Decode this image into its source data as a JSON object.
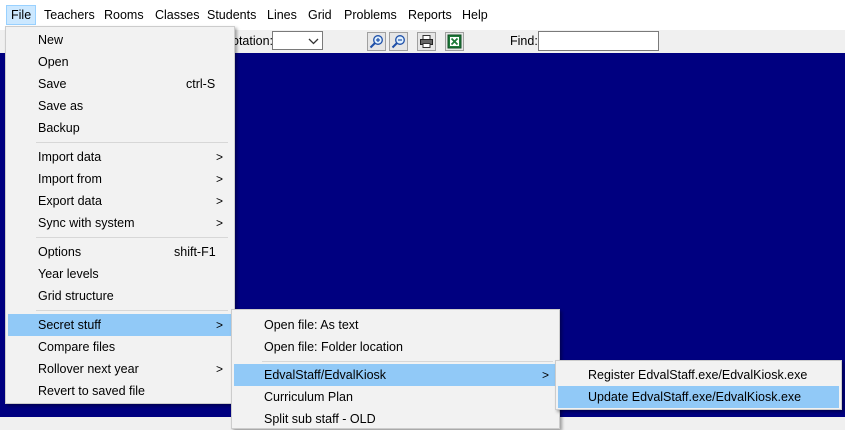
{
  "menubar": {
    "items": [
      "File",
      "Teachers",
      "Rooms",
      "Classes",
      "Students",
      "Lines",
      "Grid",
      "Problems",
      "Reports",
      "Help"
    ]
  },
  "toolbar": {
    "rotation_label": "otation:",
    "rotation_value": "",
    "find_label": "Find:",
    "find_value": "",
    "icons": [
      "zoom-in-icon",
      "zoom-out-icon",
      "print-icon",
      "excel-export-icon"
    ]
  },
  "canvas": {
    "background": "#000080"
  },
  "file_menu": {
    "items": [
      {
        "label": "New"
      },
      {
        "label": "Open"
      },
      {
        "label": "Save",
        "shortcut": "ctrl-S"
      },
      {
        "label": "Save as"
      },
      {
        "label": "Backup"
      },
      {
        "label": "Import data",
        "submenu": true
      },
      {
        "label": "Import from",
        "submenu": true
      },
      {
        "label": "Export data",
        "submenu": true
      },
      {
        "label": "Sync with system",
        "submenu": true
      },
      {
        "label": "Options",
        "shortcut": "shift-F1"
      },
      {
        "label": "Year levels"
      },
      {
        "label": "Grid structure"
      },
      {
        "label": "Secret stuff",
        "submenu": true,
        "highlighted": true
      },
      {
        "label": "Compare files"
      },
      {
        "label": "Rollover next year",
        "submenu": true
      },
      {
        "label": "Revert to saved file"
      }
    ],
    "arrow": ">"
  },
  "secret_menu": {
    "items": [
      {
        "label": "Open file: As text"
      },
      {
        "label": "Open file: Folder location"
      },
      {
        "label": "EdvalStaff/EdvalKiosk",
        "submenu": true,
        "highlighted": true
      },
      {
        "label": "Curriculum Plan"
      },
      {
        "label": "Split sub staff - OLD"
      }
    ],
    "arrow": ">"
  },
  "kiosk_menu": {
    "items": [
      {
        "label": "Register EdvalStaff.exe/EdvalKiosk.exe"
      },
      {
        "label": "Update EdvalStaff.exe/EdvalKiosk.exe",
        "highlighted": true
      }
    ]
  },
  "colors": {
    "highlight": "#91c9f7",
    "menubar_active": "#cce8ff",
    "canvas": "#000080"
  }
}
